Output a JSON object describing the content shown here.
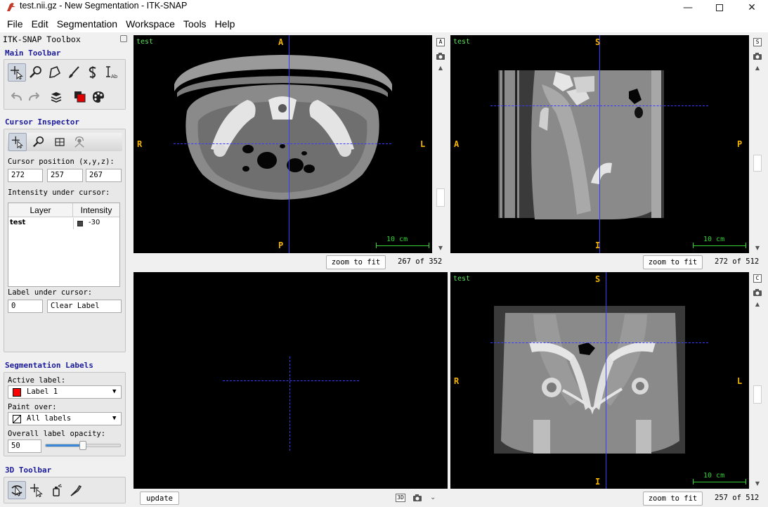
{
  "window": {
    "title": "test.nii.gz - New Segmentation - ITK-SNAP"
  },
  "menu": [
    "File",
    "Edit",
    "Segmentation",
    "Workspace",
    "Tools",
    "Help"
  ],
  "toolbox": {
    "title": "ITK-SNAP Toolbox",
    "main_toolbar_title": "Main Toolbar",
    "cursor_inspector": {
      "title": "Cursor Inspector",
      "position_label": "Cursor position (x,y,z):",
      "x": "272",
      "y": "257",
      "z": "267",
      "intensity_label": "Intensity under cursor:",
      "table_headers": [
        "Layer",
        "Intensity"
      ],
      "rows": [
        {
          "layer": "test",
          "intensity": "-30"
        }
      ],
      "label_under_cursor": "Label under cursor:",
      "label_id": "0",
      "label_name": "Clear Label"
    },
    "segmentation_labels": {
      "title": "Segmentation Labels",
      "active_label_caption": "Active label:",
      "active_label": "Label 1",
      "active_label_color": "#ff0000",
      "paint_over_caption": "Paint over:",
      "paint_over": "All labels",
      "opacity_caption": "Overall label opacity:",
      "opacity": "50",
      "opacity_fraction": 0.5
    },
    "toolbar3d_title": "3D Toolbar"
  },
  "views": {
    "axial": {
      "name": "test",
      "top": "A",
      "bottom": "P",
      "left": "R",
      "right": "L",
      "scale": "10 cm",
      "zoom_button": "zoom to fit",
      "slice": "267 of 352",
      "corner_btn": "A"
    },
    "sagittal": {
      "name": "test",
      "top": "S",
      "bottom": "I",
      "left": "A",
      "right": "P",
      "scale": "10 cm",
      "zoom_button": "zoom to fit",
      "slice": "272 of 512",
      "corner_btn": "S"
    },
    "render3d": {
      "update_button": "update",
      "corner_btn": "3D"
    },
    "coronal": {
      "name": "test",
      "top": "S",
      "bottom": "I",
      "left": "R",
      "right": "L",
      "scale": "10 cm",
      "zoom_button": "zoom to fit",
      "slice": "257 of 512",
      "corner_btn": "C"
    }
  }
}
